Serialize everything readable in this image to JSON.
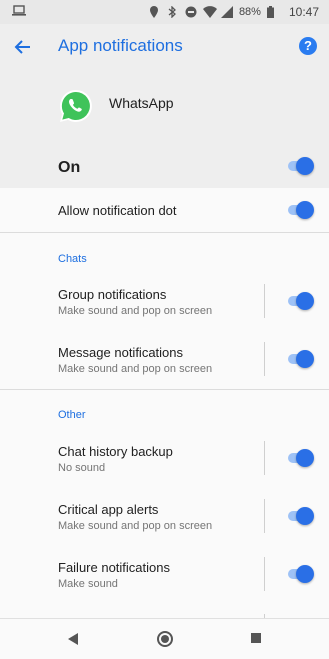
{
  "status_bar": {
    "battery": "88%",
    "time": "10:47",
    "icons": [
      "laptop-icon",
      "location-icon",
      "bluetooth-icon",
      "do-not-disturb-icon",
      "wifi-icon",
      "signal-icon",
      "battery-icon"
    ]
  },
  "app_bar": {
    "title": "App notifications",
    "back_icon": "arrow-back-icon",
    "help_icon": "help-icon",
    "accent": "#1e6fe0"
  },
  "header": {
    "app_name": "WhatsApp",
    "app_icon": "whatsapp-icon",
    "master_label": "On",
    "master_on": true
  },
  "allow_dot": {
    "label": "Allow notification dot",
    "on": true
  },
  "sections": [
    {
      "title": "Chats",
      "items": [
        {
          "label": "Group notifications",
          "sub": "Make sound and pop on screen",
          "on": true
        },
        {
          "label": "Message notifications",
          "sub": "Make sound and pop on screen",
          "on": true
        }
      ]
    },
    {
      "title": "Other",
      "items": [
        {
          "label": "Chat history backup",
          "sub": "No sound",
          "on": true
        },
        {
          "label": "Critical app alerts",
          "sub": "Make sound and pop on screen",
          "on": true
        },
        {
          "label": "Failure notifications",
          "sub": "Make sound",
          "on": true
        }
      ]
    }
  ],
  "nav_bar": {
    "icons": [
      "nav-back-icon",
      "nav-home-icon",
      "nav-recents-icon"
    ]
  }
}
